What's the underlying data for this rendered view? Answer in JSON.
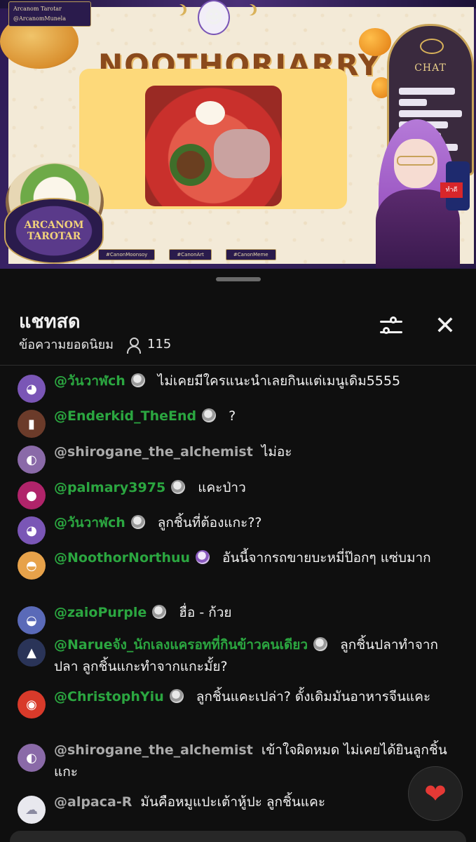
{
  "stream": {
    "top_tag_title": "Arcanom Tarotar",
    "top_tag_handle": "@ArcanomMunela",
    "banner_title": "NOOTHORJARRY",
    "logo_text": "ARCANOM TAROTAR",
    "chat_overlay_label": "CHAT",
    "mic_flag": "ทำดี",
    "hashtags": [
      "#CanonMoonsoy",
      "#CanonArt",
      "#CanonMeme"
    ]
  },
  "chat": {
    "title": "แชทสด",
    "subtitle": "ข้อความยอดนิยม",
    "viewer_count": "115",
    "close_glyph": "✕",
    "heart_glyph": "❤"
  },
  "messages": [
    {
      "author": "@วันวาฬch",
      "member": true,
      "badge": "grey",
      "text": "ไม่เคยมีใครแนะนำเลยกินแต่เมนูเดิม5555",
      "avatar_color": "#7a56b6",
      "avatar_glyph": "◕"
    },
    {
      "author": "@Enderkid_TheEnd",
      "member": true,
      "badge": "grey",
      "text": "?",
      "avatar_color": "#6b3b2a",
      "avatar_glyph": "▮"
    },
    {
      "author": "@shirogane_the_alchemist",
      "member": false,
      "badge": "",
      "text": "ไม่อะ",
      "avatar_color": "#8a6aa8",
      "avatar_glyph": "◐"
    },
    {
      "author": "@palmary3975",
      "member": true,
      "badge": "grey",
      "text": "แคะป่าว",
      "avatar_color": "#b0246a",
      "avatar_glyph": "●"
    },
    {
      "author": "@วันวาฬch",
      "member": true,
      "badge": "grey",
      "text": "ลูกชิ้นที่ต้องแกะ??",
      "avatar_color": "#7a56b6",
      "avatar_glyph": "◕"
    },
    {
      "author": "@NoothorNorthuu",
      "member": true,
      "badge": "purple",
      "text": "อันนี้จากรถขายบะหมี่ป๊อกๆ แซ่บมาก",
      "avatar_color": "#e7a24a",
      "avatar_glyph": "◓"
    },
    {
      "author": "@zaioPurple",
      "member": true,
      "badge": "grey",
      "text": "ฮื่อ - ก้วย",
      "avatar_color": "#5a6ab8",
      "avatar_glyph": "◒"
    },
    {
      "author": "@Narueจัง_นักเลงแครอทที่กินข้าวคนเดียว",
      "member": true,
      "badge": "grey",
      "text": "ลูกชิ้นปลาทำจากปลา ลูกชิ้นแกะทำจากแกะมั้ย?",
      "avatar_color": "#2a3458",
      "avatar_glyph": "▲"
    },
    {
      "author": "@ChristophYiu",
      "member": true,
      "badge": "grey",
      "text": "ลูกชิ้นแคะเปล่า? ดั้งเดิมมันอาหารจีนแคะ",
      "avatar_color": "#d83a2a",
      "avatar_glyph": "◉"
    },
    {
      "author": "@shirogane_the_alchemist",
      "member": false,
      "badge": "",
      "text": "เข้าใจผิดหมด ไม่เคยได้ยินลูกชิ้นแกะ",
      "avatar_color": "#8a6aa8",
      "avatar_glyph": "◐"
    },
    {
      "author": "@alpaca-R",
      "member": false,
      "badge": "",
      "text": "มันคือหมูแปะเต้าหู้ปะ ลูกชิ้นแคะ",
      "avatar_color": "#e8e8ee",
      "avatar_glyph": "☁"
    }
  ]
}
